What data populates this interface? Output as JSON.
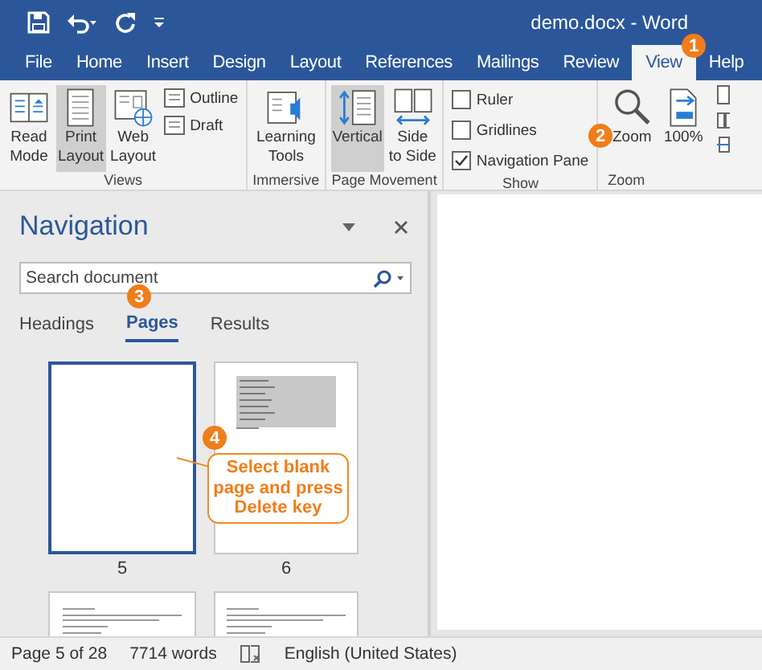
{
  "title_bar": {
    "title": "demo.docx - Word"
  },
  "tabs": [
    {
      "label": "File",
      "selected": false
    },
    {
      "label": "Home",
      "selected": false
    },
    {
      "label": "Insert",
      "selected": false
    },
    {
      "label": "Design",
      "selected": false
    },
    {
      "label": "Layout",
      "selected": false
    },
    {
      "label": "References",
      "selected": false
    },
    {
      "label": "Mailings",
      "selected": false
    },
    {
      "label": "Review",
      "selected": false
    },
    {
      "label": "View",
      "selected": true
    },
    {
      "label": "Help",
      "selected": false
    }
  ],
  "ribbon": {
    "groups": [
      {
        "label": "Views",
        "items": [
          {
            "kind": "large",
            "lines": [
              "Read",
              "Mode"
            ],
            "selected": false
          },
          {
            "kind": "large",
            "lines": [
              "Print",
              "Layout"
            ],
            "selected": true
          },
          {
            "kind": "large",
            "lines": [
              "Web",
              "Layout"
            ],
            "selected": false
          },
          {
            "kind": "small",
            "label": "Outline"
          },
          {
            "kind": "small",
            "label": "Draft"
          }
        ]
      },
      {
        "label": "Immersive",
        "items": [
          {
            "kind": "large",
            "lines": [
              "Learning",
              "Tools"
            ],
            "selected": false
          }
        ]
      },
      {
        "label": "Page Movement",
        "items": [
          {
            "kind": "large",
            "lines": [
              "Vertical"
            ],
            "selected": true
          },
          {
            "kind": "large",
            "lines": [
              "Side",
              "to Side"
            ],
            "selected": false
          }
        ]
      },
      {
        "label": "Show",
        "items": [
          {
            "kind": "check",
            "label": "Ruler",
            "checked": false
          },
          {
            "kind": "check",
            "label": "Gridlines",
            "checked": false
          },
          {
            "kind": "check",
            "label": "Navigation Pane",
            "checked": true
          }
        ]
      },
      {
        "label": "Zoom",
        "items": [
          {
            "kind": "large",
            "lines": [
              "Zoom"
            ],
            "selected": false
          },
          {
            "kind": "large",
            "lines": [
              "100%"
            ],
            "selected": false
          }
        ]
      }
    ]
  },
  "navigation": {
    "title": "Navigation",
    "search": {
      "placeholder": "Search document"
    },
    "tabs": [
      {
        "label": "Headings",
        "selected": false
      },
      {
        "label": "Pages",
        "selected": true
      },
      {
        "label": "Results",
        "selected": false
      }
    ],
    "pages": [
      {
        "kind": "blank",
        "number": "5",
        "selected": true
      },
      {
        "kind": "table",
        "number": "6",
        "selected": false
      },
      {
        "kind": "text",
        "selected": false
      },
      {
        "kind": "text",
        "selected": false
      }
    ]
  },
  "steps": [
    {
      "number": "1"
    },
    {
      "number": "2"
    },
    {
      "number": "3"
    },
    {
      "number": "4",
      "callout": "Select blank page and press Delete key"
    }
  ],
  "status_bar": {
    "page": "Page 5 of 28",
    "words": "7714 words",
    "language": "English (United States)"
  }
}
